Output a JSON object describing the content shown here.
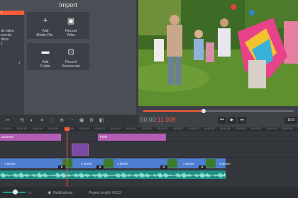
{
  "import_panel": {
    "title": "Import",
    "list": [
      "s",
      "de video",
      "ecords",
      "deos",
      "s"
    ],
    "tiles": [
      {
        "icon": "plus-icon",
        "glyph": "+",
        "label": "Add\nMedia Files"
      },
      {
        "icon": "video-camera-icon",
        "glyph": "▣",
        "label": "Record\nVideo"
      },
      {
        "icon": "folder-icon",
        "glyph": "▬",
        "label": "Add\nFolder"
      },
      {
        "icon": "screen-record-icon",
        "glyph": "⊡",
        "label": "Record\nScreencast"
      }
    ]
  },
  "player": {
    "timecode_dim": "00:00:",
    "timecode_hi": "11.009",
    "progress": 0.4,
    "aspect": "16:9",
    "buttons": [
      "⏮",
      "▶",
      "⏭"
    ]
  },
  "toolbar": {
    "items": [
      "✂",
      "⟲",
      "◐",
      "≡",
      "⬚",
      "⊕",
      "◔",
      "▣",
      "⚙",
      "◧"
    ]
  },
  "ruler": {
    "ticks": [
      "00:00:00",
      "00:00:02",
      "00:00:04",
      "00:00:06",
      "00:00:08",
      "00:00:10",
      "00:00:12",
      "00:00:14",
      "00:00:16",
      "00:00:18",
      "00:00:20",
      "00:00:22",
      "00:00:24",
      "00:00:26",
      "00:00:28",
      "00:00:30",
      "00:00:32",
      "00:00:34",
      "00:00:36"
    ]
  },
  "timeline": {
    "title_clip_1": "Summer",
    "title_clip_2": "Title",
    "video_labels": [
      "1.Movie",
      "2.Movie",
      "3.Movie",
      "4.Movie",
      "5.Movie"
    ]
  },
  "status": {
    "notifications": "Notifications",
    "project_length": "Project length:  00:32"
  },
  "colors": {
    "accent": "#ff5b3a",
    "video_track": "#4e7ed0",
    "audio_track": "#1f8d83",
    "title_clip": "#b45db4"
  }
}
